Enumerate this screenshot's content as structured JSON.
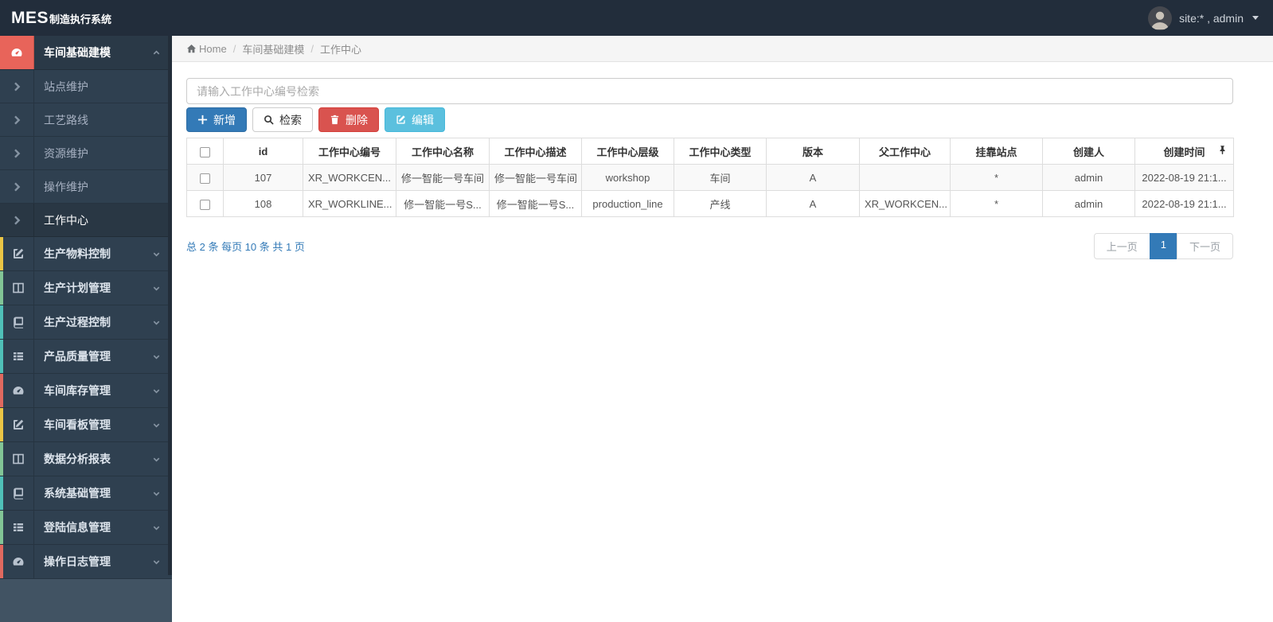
{
  "header": {
    "logo_mes": "MES",
    "logo_suffix": "制造执行系统",
    "user_label": "site:* , admin"
  },
  "sidebar": {
    "group": {
      "label": "车间基础建模",
      "icon": "tachometer-icon",
      "icon_bg": "#e8645a"
    },
    "subitems": [
      {
        "label": "站点维护"
      },
      {
        "label": "工艺路线"
      },
      {
        "label": "资源维护"
      },
      {
        "label": "操作维护"
      },
      {
        "label": "工作中心",
        "active": true
      }
    ],
    "items": [
      {
        "label": "生产物料控制",
        "icon": "edit-icon",
        "strip": "#eac545"
      },
      {
        "label": "生产计划管理",
        "icon": "columns-icon",
        "strip": "#82c596"
      },
      {
        "label": "生产过程控制",
        "icon": "book-icon",
        "strip": "#4fc0b8"
      },
      {
        "label": "产品质量管理",
        "icon": "list-icon",
        "strip": "#4fc0b8"
      },
      {
        "label": "车间库存管理",
        "icon": "tachometer-icon",
        "strip": "#e0695f"
      },
      {
        "label": "车间看板管理",
        "icon": "edit-icon",
        "strip": "#eac545"
      },
      {
        "label": "数据分析报表",
        "icon": "columns-icon",
        "strip": "#82c596"
      },
      {
        "label": "系统基础管理",
        "icon": "book-icon",
        "strip": "#4fc0b8"
      },
      {
        "label": "登陆信息管理",
        "icon": "list-icon",
        "strip": "#82c596"
      },
      {
        "label": "操作日志管理",
        "icon": "tachometer-icon",
        "strip": "#e0695f"
      }
    ]
  },
  "breadcrumb": {
    "home": "Home",
    "level1": "车间基础建模",
    "level2": "工作中心"
  },
  "search": {
    "placeholder": "请输入工作中心编号检索",
    "value": ""
  },
  "toolbar": {
    "add": "新增",
    "search": "检索",
    "delete": "删除",
    "edit": "编辑"
  },
  "table": {
    "headers": [
      "id",
      "工作中心编号",
      "工作中心名称",
      "工作中心描述",
      "工作中心层级",
      "工作中心类型",
      "版本",
      "父工作中心",
      "挂靠站点",
      "创建人",
      "创建时间"
    ],
    "rows": [
      [
        "107",
        "XR_WORKCEN...",
        "修一智能一号车间",
        "修一智能一号车间",
        "workshop",
        "车间",
        "A",
        "",
        "*",
        "admin",
        "2022-08-19 21:1..."
      ],
      [
        "108",
        "XR_WORKLINE...",
        "修一智能一号S...",
        "修一智能一号S...",
        "production_line",
        "产线",
        "A",
        "XR_WORKCEN...",
        "*",
        "admin",
        "2022-08-19 21:1..."
      ]
    ]
  },
  "footer": {
    "summary": "总 2 条 每页 10 条 共 1 页",
    "prev": "上一页",
    "page": "1",
    "next": "下一页"
  },
  "colors": {
    "topbar_bg": "#222d3b",
    "sidebar_bg": "#2f4050",
    "active_icon_bg": "#e8645a",
    "primary": "#337ab7",
    "danger": "#d9534f",
    "info": "#5bc0de",
    "link_blue": "#337ab7"
  }
}
